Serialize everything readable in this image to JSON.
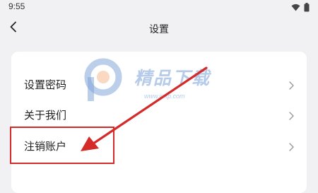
{
  "status_bar": {
    "time": "9:55",
    "icons": [
      "wifi-icon",
      "battery-icon"
    ]
  },
  "header": {
    "title": "设置",
    "back_icon": "chevron-left-icon"
  },
  "settings": {
    "items": [
      {
        "label": "设置密码"
      },
      {
        "label": "关于我们"
      },
      {
        "label": "注销账户"
      }
    ]
  },
  "watermark": {
    "text": "精品下载",
    "url": "www.jpxp.com"
  },
  "colors": {
    "background": "#f1f1f3",
    "card": "#ffffff",
    "annotation": "#d42a2a",
    "watermark": "#78a0d7"
  }
}
